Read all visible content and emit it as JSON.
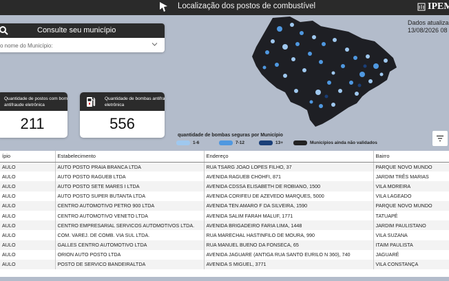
{
  "header": {
    "title": "Localização dos postos de combustível",
    "brand": "IPEM"
  },
  "search": {
    "title": "Consulte seu município",
    "placeholder": "o nome do Município:"
  },
  "kpis": [
    {
      "label": "Quantidade de postos com bomba antifraude eletrônica",
      "value": "211"
    },
    {
      "label": "Quantidade de bombas antifraude eletrônica",
      "value": "556"
    }
  ],
  "updated": {
    "line1": "Dados atualiza",
    "line2": "13/08/2026 08"
  },
  "legend": {
    "title": "quantidade de bombas seguras por Município",
    "items": [
      {
        "label": "1-6",
        "color": "#9fc8ef"
      },
      {
        "label": "7-12",
        "color": "#4f98e0"
      },
      {
        "label": "13+",
        "color": "#1a3f78"
      },
      {
        "label": "Municípios ainda não validados",
        "color": "#222222"
      }
    ]
  },
  "map_colors": {
    "dark": "#1e1f24",
    "light": "#9fc8ef",
    "mid": "#4f98e0",
    "deep": "#1a3f78"
  },
  "table": {
    "columns": [
      "ípio",
      "Estabelecimento",
      "Endereço",
      "Bairro"
    ],
    "rows": [
      [
        "AULO",
        "AUTO POSTO PRAIA BRANCA LTDA",
        "RUA TSARG JOAO LOPES FILHO, 37",
        "PARQUE NOVO MUNDO"
      ],
      [
        "AULO",
        "AUTO POSTO RAGUEB LTDA",
        "AVENIDA RAGUEB CHOHFI, 871",
        "JARDIM TRÊS MARIAS"
      ],
      [
        "AULO",
        "AUTO POSTO SETE MARES I LTDA",
        "AVENIDA CDSSA ELISABETH DE ROBIANO, 1500",
        "VILA MOREIRA"
      ],
      [
        "AULO",
        "AUTO POSTO SUPER BUTANTA LTDA",
        "AVENIDA CORIFEU DE AZEVEDO MARQUES, 5000",
        "VILA LAGEADO"
      ],
      [
        "AULO",
        "CENTRO AUTOMOTIVO PETRO 900 LTDA",
        "AVENIDA TEN AMARO F DA SILVEIRA, 1590",
        "PARQUE NOVO MUNDO"
      ],
      [
        "AULO",
        "CENTRO AUTOMOTIVO VENETO LTDA",
        "AVENIDA SALIM FARAH MALUF, 1771",
        "TATUAPÉ"
      ],
      [
        "AULO",
        "CENTRO EMPRESARIAL SERVICOS AUTOMOTIVOS LTDA.",
        "AVENIDA BRIGADEIRO FARIA LIMA, 1448",
        "JARDIM PAULISTANO"
      ],
      [
        "AULO",
        "COM. VAREJ. DE COMB. VIA SUL LTDA.",
        "RUA MARECHAL HASTINFILO DE MOURA, 990",
        "VILA SUZANA"
      ],
      [
        "AULO",
        "GALLES CENTRO AUTOMOTIVO LTDA",
        "RUA MANUEL BUENO DA FONSECA, 65",
        "ITAIM PAULISTA"
      ],
      [
        "AULO",
        "ORION AUTO POSTO LTDA",
        "AVENIDA JAGUARE (ANTIGA RUA SANTO EURILO N 360), 740",
        "JAGUARÉ"
      ],
      [
        "AULO",
        "POSTO DE SERVICO BANDEIRALTDA",
        "AVENIDA S MIGUEL, 3771",
        "VILA CONSTANÇA"
      ]
    ]
  }
}
